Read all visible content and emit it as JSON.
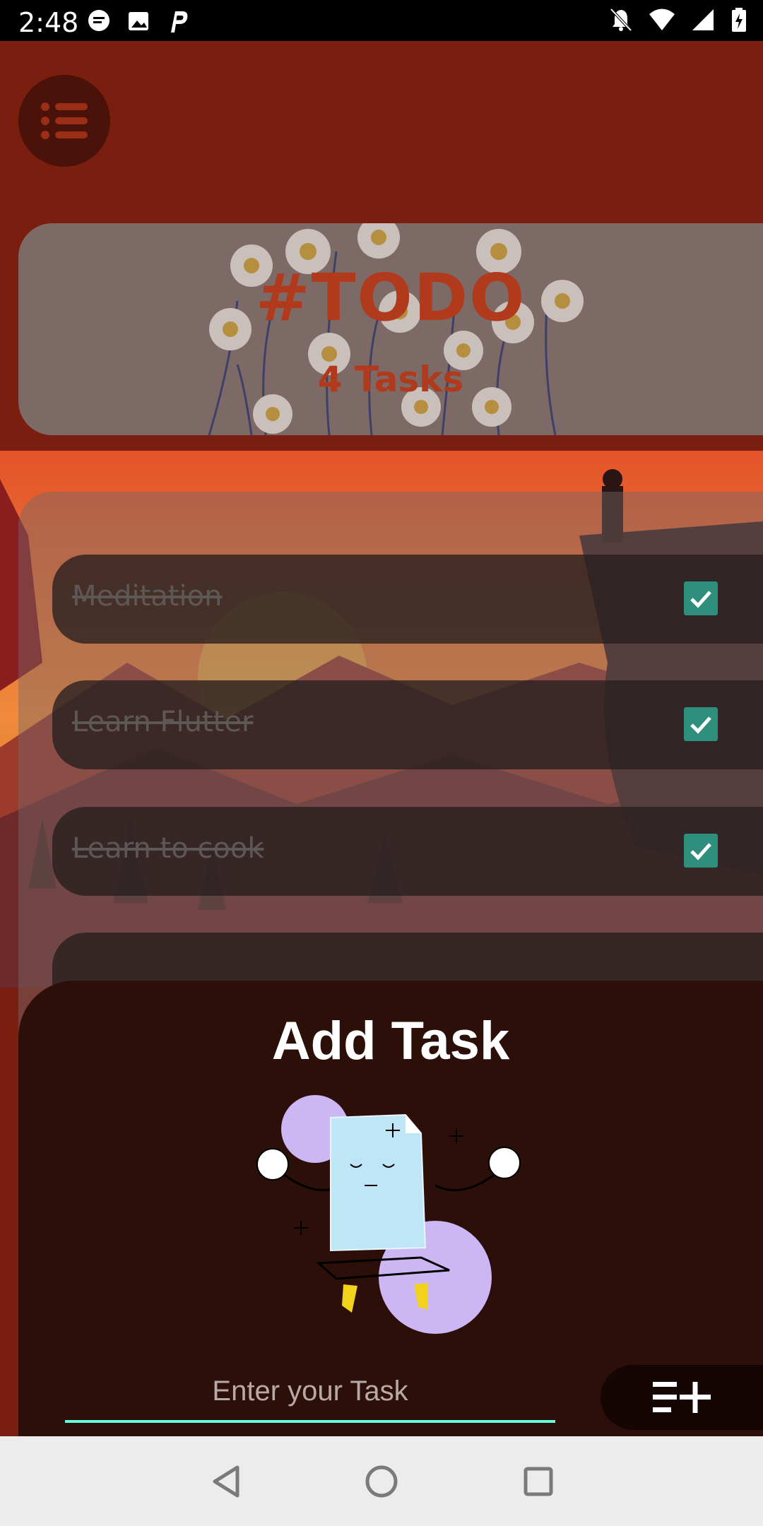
{
  "status_bar": {
    "time": "2:48",
    "left_icons": [
      "message-icon",
      "image-icon",
      "p-icon"
    ],
    "right_icons": [
      "notifications-off-icon",
      "wifi-icon",
      "signal-icon",
      "battery-icon"
    ]
  },
  "menu": {
    "icon": "list-menu-icon"
  },
  "header": {
    "title": "#TODO",
    "task_count": "4 Tasks"
  },
  "tasks": [
    {
      "label": "Meditation",
      "done": true
    },
    {
      "label": "Learn Flutter",
      "done": true
    },
    {
      "label": "Learn to cook",
      "done": true
    }
  ],
  "sheet": {
    "title": "Add Task",
    "input_placeholder": "Enter your Task",
    "add_icon": "playlist-add-icon"
  },
  "colors": {
    "accent": "#64ffda",
    "title_red": "#b1391c",
    "check_green": "#2f8f7c",
    "sheet_bg": "#2b0f08"
  },
  "nav": [
    "back-icon",
    "home-icon",
    "recents-icon"
  ]
}
